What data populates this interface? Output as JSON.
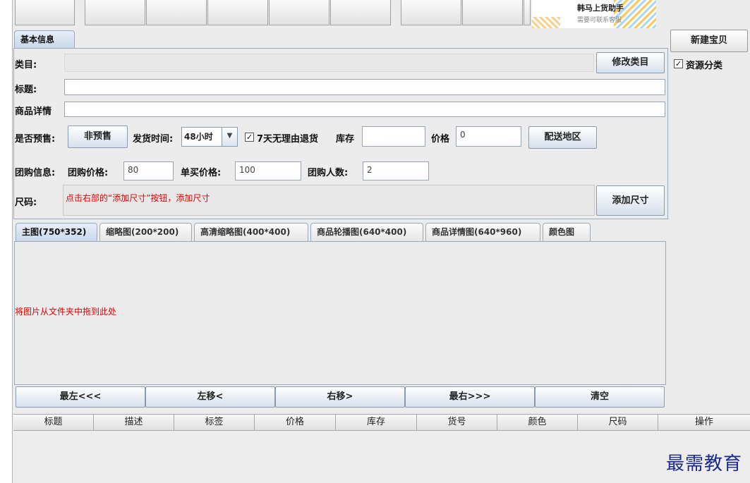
{
  "toolbar": {
    "buttons": [
      "",
      "",
      "",
      "",
      "",
      "",
      "",
      "",
      ""
    ]
  },
  "banner": {
    "title": "韩马上货助手",
    "subtitle": "需要可联系客服"
  },
  "basic_tab": "基本信息",
  "right_panel": {
    "new_button": "新建宝贝",
    "resource_label": "资源分类",
    "resource_checked": true
  },
  "form": {
    "category_label": "类目:",
    "category_value": "",
    "modify_category_button": "修改类目",
    "title_label": "标题:",
    "title_value": "",
    "detail_label": "商品详情",
    "detail_value": "",
    "presale_label": "是否预售:",
    "presale_button": "非预售",
    "ship_time_label": "发货时间:",
    "ship_time_value": "48小时",
    "return_label": "7天无理由退货",
    "return_checked": true,
    "stock_label": "库存",
    "stock_value": "",
    "price_label": "价格",
    "price_value": "0",
    "delivery_button": "配送地区",
    "group_info_label": "团购信息:",
    "group_price_label": "团购价格:",
    "group_price_value": "80",
    "single_price_label": "单买价格:",
    "single_price_value": "100",
    "group_count_label": "团购人数:",
    "group_count_value": "2",
    "size_label": "尺码:",
    "size_hint": "点击右部的“添加尺寸”按钮，添加尺寸",
    "add_size_button": "添加尺寸"
  },
  "image_tabs": [
    "主图(750*352)",
    "缩略图(200*200)",
    "高清缩略图(400*400)",
    "商品轮播图(640*400)",
    "商品详情图(640*960)",
    "颜色图"
  ],
  "drop_hint": "将图片从文件夹中拖到此处",
  "image_buttons": [
    "最左<<<",
    "左移<",
    "右移>",
    "最右>>>",
    "清空"
  ],
  "table_headers": [
    "标题",
    "描述",
    "标签",
    "价格",
    "库存",
    "货号",
    "颜色",
    "尺码",
    "操作"
  ],
  "watermark": "最需教育"
}
